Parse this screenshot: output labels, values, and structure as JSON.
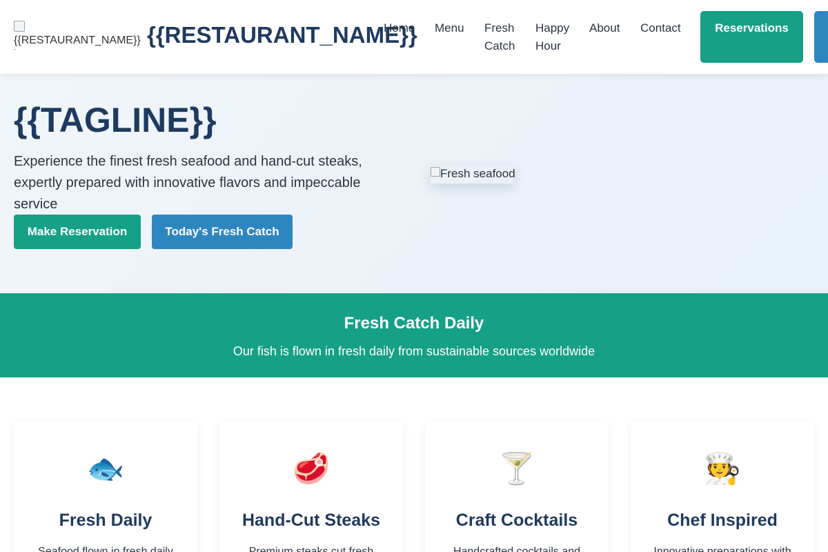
{
  "header": {
    "logo_alt": "{{RESTAURANT_NAME}}",
    "brand": "{{RESTAURANT_NAME}}",
    "nav": {
      "home": "Home",
      "menu": "Menu",
      "fresh_line1": "Fresh",
      "fresh_line2": "Catch",
      "happy_line1": "Happy",
      "happy_line2": "Hour",
      "about": "About",
      "contact": "Contact"
    },
    "reservations_button": "Reservations"
  },
  "hero": {
    "tagline": "{{TAGLINE}}",
    "description_line1": "Experience the finest fresh seafood and hand-cut steaks,",
    "description_line2": "expertly prepared with innovative flavors and impeccable service",
    "primary_button": "Make Reservation",
    "secondary_button": "Today's Fresh Catch",
    "image_alt": "Fresh seafood"
  },
  "banner": {
    "title": "Fresh Catch Daily",
    "text": "Our fish is flown in fresh daily from sustainable sources worldwide"
  },
  "features": [
    {
      "icon": "🐟",
      "icon_name": "fish-icon",
      "title": "Fresh Daily",
      "description": "Seafood flown in fresh daily"
    },
    {
      "icon": "🥩",
      "icon_name": "steak-icon",
      "title": "Hand-Cut Steaks",
      "description": "Premium steaks cut fresh"
    },
    {
      "icon": "🍸",
      "icon_name": "cocktail-icon",
      "title": "Craft Cocktails",
      "description": "Handcrafted cocktails and"
    },
    {
      "icon": "🧑‍🍳",
      "icon_name": "chef-icon",
      "title": "Chef Inspired",
      "description": "Innovative preparations with"
    }
  ],
  "colors": {
    "primary_teal": "#16a085",
    "secondary_blue": "#2e86c1",
    "heading_navy": "#1e3a5f"
  }
}
